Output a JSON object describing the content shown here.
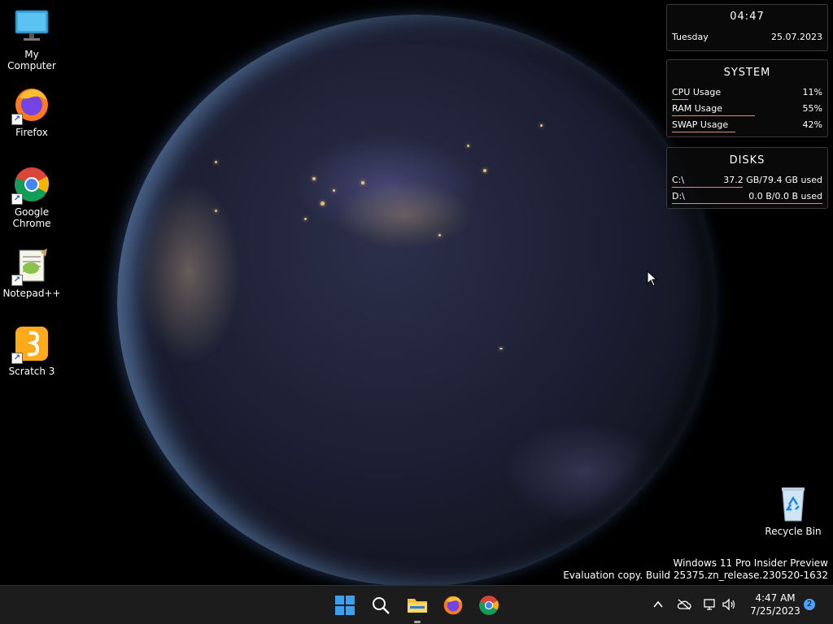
{
  "desktop": {
    "icons": [
      {
        "label": "My Computer",
        "icon": "monitor-icon"
      },
      {
        "label": "Firefox",
        "icon": "firefox-icon"
      },
      {
        "label": "Google Chrome",
        "icon": "chrome-icon"
      },
      {
        "label": "Notepad++",
        "icon": "notepadpp-icon"
      },
      {
        "label": "Scratch 3",
        "icon": "scratch-icon"
      },
      {
        "label": "Recycle Bin",
        "icon": "recycle-bin-icon"
      }
    ]
  },
  "clock_widget": {
    "time": "04:47",
    "day": "Tuesday",
    "date": "25.07.2023"
  },
  "system_widget": {
    "title": "SYSTEM",
    "rows": [
      {
        "label": "CPU Usage",
        "value": "11%",
        "fill": 0.11
      },
      {
        "label": "RAM Usage",
        "value": "55%",
        "fill": 0.55
      },
      {
        "label": "SWAP Usage",
        "value": "42%",
        "fill": 0.42
      }
    ]
  },
  "disks_widget": {
    "title": "DISKS",
    "rows": [
      {
        "label": "C:\\",
        "value": "37.2 GB/79.4 GB used",
        "fill": 0.47
      },
      {
        "label": "D:\\",
        "value": "0.0 B/0.0 B used",
        "fill": 1.0
      }
    ]
  },
  "watermark": {
    "line1": "Windows 11 Pro Insider Preview",
    "line2": "Evaluation copy. Build 25375.zn_release.230520-1632"
  },
  "taskbar": {
    "apps": [
      "start-icon",
      "search-icon",
      "file-explorer-icon",
      "firefox-icon",
      "chrome-icon"
    ],
    "tray": {
      "time": "4:47 AM",
      "date": "7/25/2023",
      "notifications": "2"
    }
  },
  "colors": {
    "accent": "#e38d6a",
    "taskbar": "#1c1c1c",
    "notif": "#4aa3ff"
  }
}
